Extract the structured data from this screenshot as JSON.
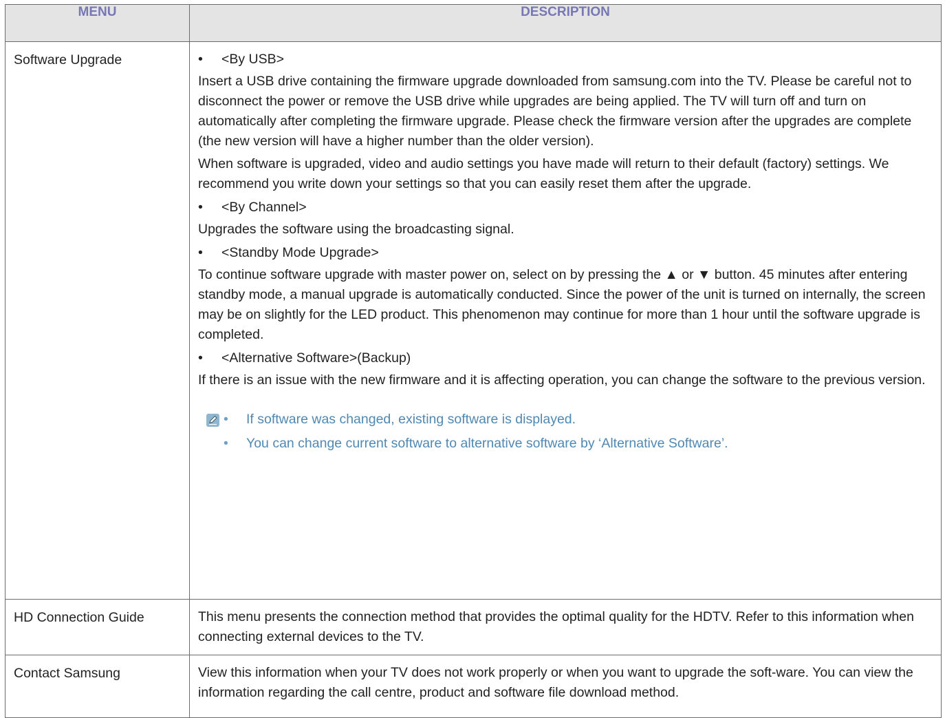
{
  "header": {
    "menu_label": "MENU",
    "description_label": "DESCRIPTION"
  },
  "rows": [
    {
      "menu": "Software Upgrade",
      "blocks": [
        "<By USB>",
        "Insert a USB drive containing the firmware upgrade downloaded from samsung.com into the TV. Please be careful not to disconnect the power or remove the USB drive while upgrades are being applied. The TV will turn off and turn on automatically after completing the firmware upgrade. Please check the firmware version after the upgrades are complete (the new version will have a higher number than the older version).",
        "When software is upgraded, video and audio settings you have made will return to their default (factory) settings. We recommend you write down your settings so that you can easily reset them after the upgrade.",
        "<By Channel>",
        "Upgrades the software using the broadcasting signal.",
        "<Standby Mode Upgrade>",
        "To continue software upgrade with master power on, select on by pressing the ▲ or ▼ button. 45 minutes after entering standby mode, a manual upgrade is automatically conducted. Since the power of the unit is turned on internally, the screen may be on slightly for the LED product. This phenomenon may continue for more than 1 hour until the software upgrade is completed.",
        "<Alternative Software>(Backup)",
        "If there is an issue with the new firmware and it is affecting operation, you can change the software to the previous version."
      ],
      "notes": [
        "If software was changed, existing software is displayed.",
        "You can change current software to alternative software by ‘Alternative Software’."
      ]
    },
    {
      "menu": "HD Connection Guide",
      "description": "This menu presents the connection method that provides the optimal quality for the HDTV. Refer to this information when connecting external devices to the TV."
    },
    {
      "menu": "Contact Samsung",
      "description": "View this information when your TV does not work properly or when you want to upgrade the soft-ware. You can view the information regarding the call centre, product and software file download method."
    }
  ],
  "colors": {
    "header_text": "#7777b5",
    "header_bg": "#e4e4e4",
    "note_text": "#4f89b3",
    "border": "#6b6b6b"
  },
  "icons": {
    "note": "note-pencil-icon"
  }
}
